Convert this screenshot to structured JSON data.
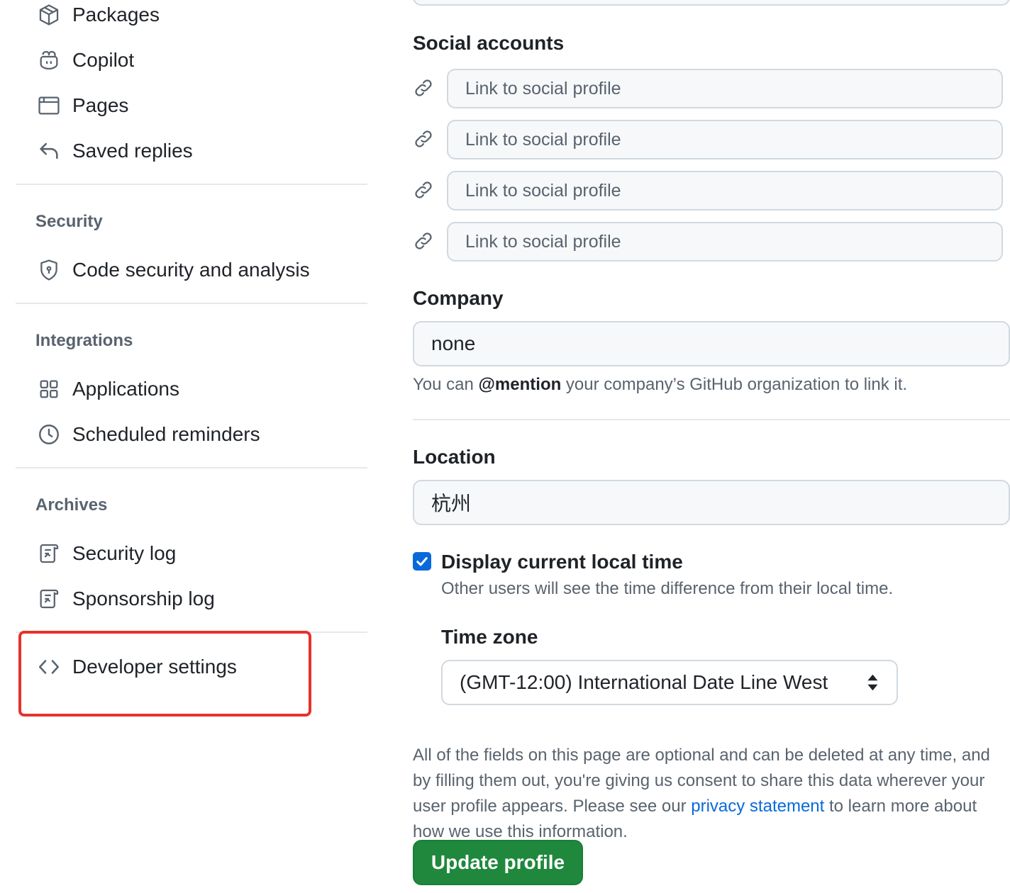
{
  "sidebar": {
    "top_items": [
      {
        "label": "Packages",
        "icon": "package-icon"
      },
      {
        "label": "Copilot",
        "icon": "copilot-icon"
      },
      {
        "label": "Pages",
        "icon": "browser-icon"
      },
      {
        "label": "Saved replies",
        "icon": "reply-icon"
      }
    ],
    "security": {
      "heading": "Security",
      "items": [
        {
          "label": "Code security and analysis",
          "icon": "shield-lock-icon"
        }
      ]
    },
    "integrations": {
      "heading": "Integrations",
      "items": [
        {
          "label": "Applications",
          "icon": "apps-icon"
        },
        {
          "label": "Scheduled reminders",
          "icon": "clock-icon"
        }
      ]
    },
    "archives": {
      "heading": "Archives",
      "items": [
        {
          "label": "Security log",
          "icon": "log-icon"
        },
        {
          "label": "Sponsorship log",
          "icon": "log-icon"
        }
      ]
    },
    "developer_settings": {
      "label": "Developer settings",
      "icon": "code-icon",
      "highlighted": true
    }
  },
  "form": {
    "social_accounts": {
      "label": "Social accounts",
      "placeholder": "Link to social profile",
      "values": [
        "",
        "",
        "",
        ""
      ]
    },
    "company": {
      "label": "Company",
      "value": "none",
      "hint_prefix": "You can ",
      "hint_mention": "@mention",
      "hint_suffix": " your company’s GitHub organization to link it."
    },
    "location": {
      "label": "Location",
      "value": "杭州"
    },
    "local_time": {
      "checked": true,
      "label": "Display current local time",
      "description": "Other users will see the time difference from their local time."
    },
    "time_zone": {
      "label": "Time zone",
      "selected": "(GMT-12:00) International Date Line West"
    },
    "disclaimer": {
      "before_link": "All of the fields on this page are optional and can be deleted at any time, and by filling them out, you're giving us consent to share this data wherever your user profile appears. Please see our ",
      "link_text": "privacy statement",
      "after_link": " to learn more about how we use this information."
    },
    "submit_label": "Update profile"
  },
  "colors": {
    "accent": "#0969da",
    "primary_button": "#1f883d",
    "highlight_border": "#e5322d"
  }
}
